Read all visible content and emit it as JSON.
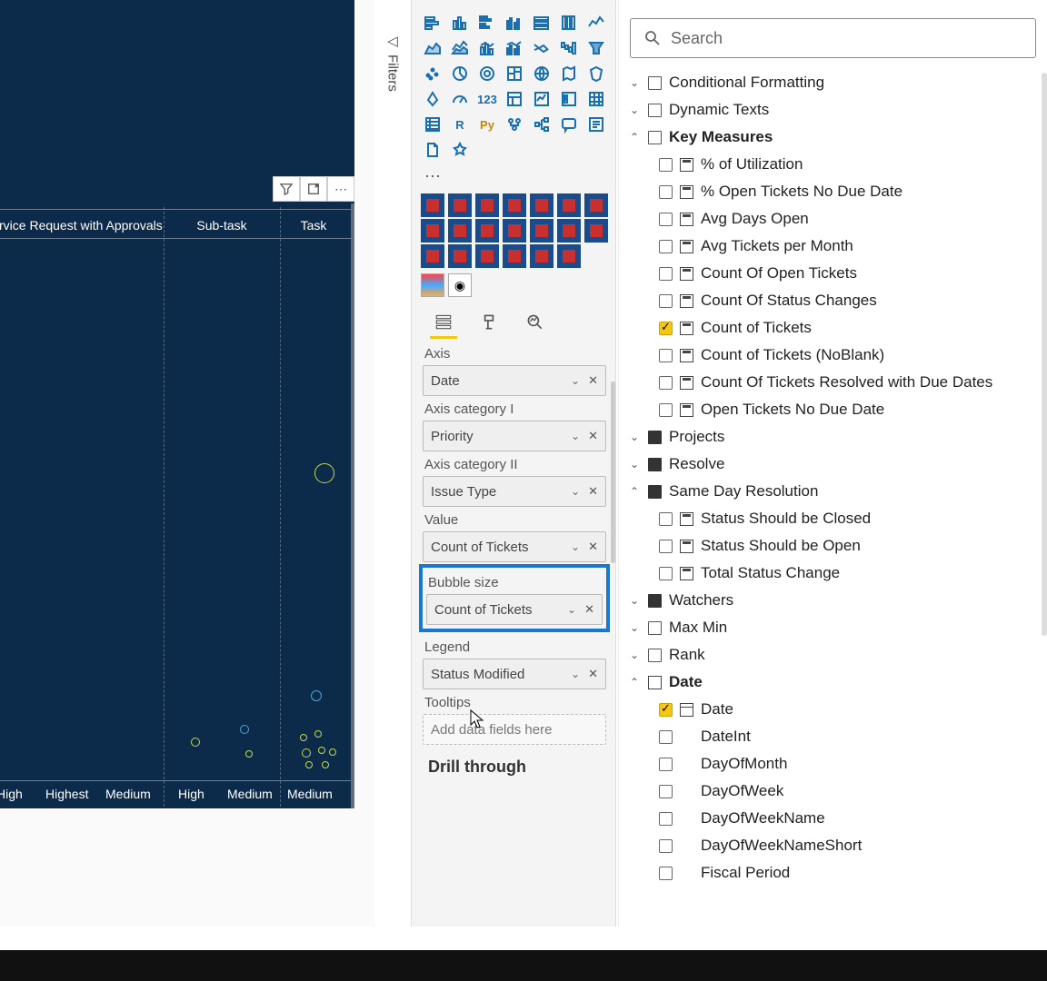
{
  "filters_label": "Filters",
  "chart": {
    "columns": [
      "ervice Request with Approvals",
      "Sub-task",
      "Task"
    ],
    "footers": [
      "High",
      "Highest",
      "Medium",
      "High",
      "Medium",
      "Medium"
    ]
  },
  "field_wells": {
    "axis_label": "Axis",
    "axis_value": "Date",
    "cat1_label": "Axis category I",
    "cat1_value": "Priority",
    "cat2_label": "Axis category II",
    "cat2_value": "Issue Type",
    "value_label": "Value",
    "value_value": "Count of Tickets",
    "bubble_label": "Bubble size",
    "bubble_value": "Count of Tickets",
    "legend_label": "Legend",
    "legend_value": "Status Modified",
    "tooltips_label": "Tooltips",
    "tooltips_placeholder": "Add data fields here",
    "drill_label": "Drill through"
  },
  "search_placeholder": "Search",
  "fields": {
    "conditional": "Conditional Formatting",
    "dynamic": "Dynamic Texts",
    "keymeasures": "Key Measures",
    "km_items": [
      "% of Utilization",
      "% Open Tickets No Due Date",
      "Avg Days Open",
      "Avg Tickets per Month",
      "Count Of Open Tickets",
      "Count Of Status Changes",
      "Count of Tickets",
      "Count of Tickets (NoBlank)",
      "Count Of Tickets Resolved with Due Dates",
      "Open Tickets No Due Date"
    ],
    "projects": "Projects",
    "resolve": "Resolve",
    "sameday": "Same Day Resolution",
    "sd_items": [
      "Status Should be Closed",
      "Status Should be Open",
      "Total Status Change"
    ],
    "watchers": "Watchers",
    "maxmin": "Max Min",
    "rank": "Rank",
    "date": "Date",
    "date_items": [
      "Date",
      "DateInt",
      "DayOfMonth",
      "DayOfWeek",
      "DayOfWeekName",
      "DayOfWeekNameShort",
      "Fiscal Period"
    ]
  }
}
